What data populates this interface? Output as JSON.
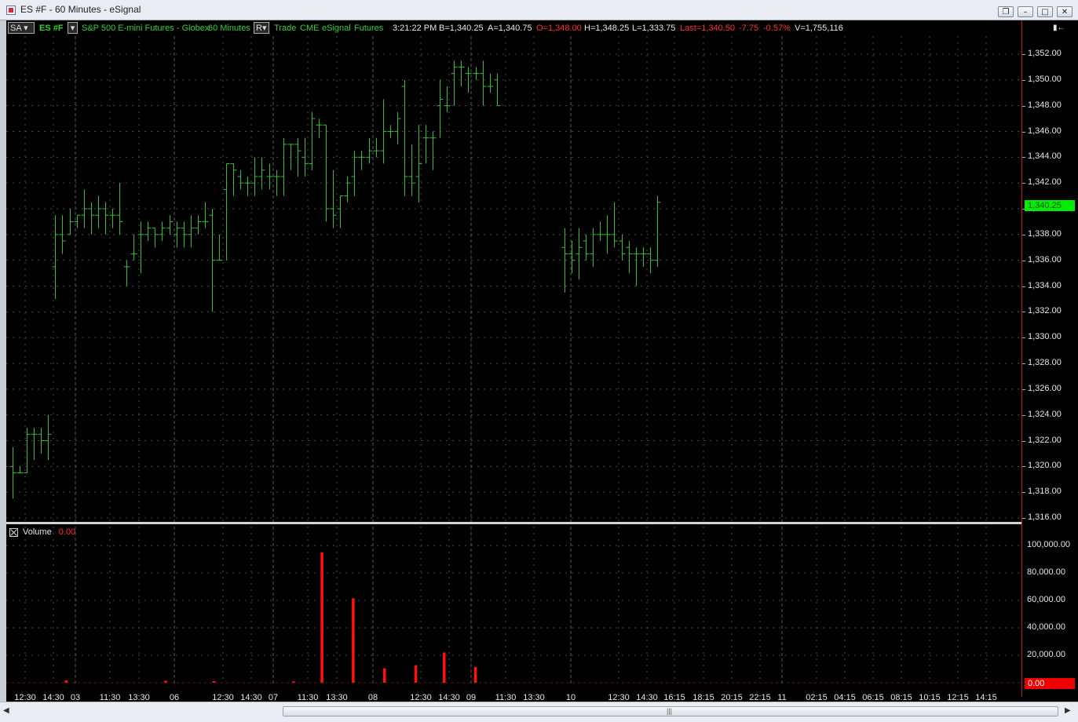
{
  "window": {
    "title": "ES #F - 60 Minutes - eSignal",
    "buttons": [
      "❐",
      "–",
      "□",
      "✕"
    ]
  },
  "toolbar": {
    "sa": "SA",
    "symbol": "ES #F",
    "description": "S&P 500 E-mini Futures - Globex",
    "interval": "60 Minutes",
    "r": "R",
    "trade": "Trade",
    "exchange": "CME",
    "source": "eSignal",
    "type": "Futures",
    "time": "3:21:22 PM",
    "bid": "B=1,340.25",
    "ask": "A=1,340.75",
    "open": "O=1,348.00",
    "high": "H=1,348.25",
    "low": "L=1,333.75",
    "last": "Last=1,340.50",
    "change": "-7.75",
    "change_pct": "-0.57%",
    "volume": "V=1,755,116",
    "menu_glyph": "▮←"
  },
  "price_axis": {
    "labels": [
      "1,352.00",
      "1,350.00",
      "1,348.00",
      "1,346.00",
      "1,344.00",
      "1,342.00",
      "1,340.00",
      "1,338.00",
      "1,336.00",
      "1,334.00",
      "1,332.00",
      "1,330.00",
      "1,328.00",
      "1,326.00",
      "1,324.00",
      "1,322.00",
      "1,320.00",
      "1,318.00",
      "1,316.00"
    ],
    "current_label": "1,340.25",
    "current_value": 1340.25
  },
  "volume_pane": {
    "title": "Volume",
    "value": "0.00",
    "axis_labels": [
      "100,000.00",
      "80,000.00",
      "60,000.00",
      "40,000.00",
      "20,000.00"
    ],
    "current_label": "0.00"
  },
  "time_axis": {
    "labels": [
      "12:30",
      "14:30",
      "03",
      "11:30",
      "13:30",
      "06",
      "12:30",
      "14:30",
      "07",
      "11:30",
      "13:30",
      "08",
      "12:30",
      "14:30",
      "09",
      "11:30",
      "13:30",
      "10",
      "12:30",
      "14:30",
      "16:15",
      "18:15",
      "20:15",
      "22:15",
      "11",
      "02:15",
      "04:15",
      "06:15",
      "08:15",
      "10:15",
      "12:15",
      "14:15"
    ]
  },
  "colors": {
    "bar": "#2fc02f",
    "volume": "#ff1010",
    "grid": "#4a4a4a",
    "price_marker": "#00ee00",
    "volume_marker": "#ee0000"
  },
  "chart_data": [
    {
      "type": "ohlc",
      "title": "S&P 500 E-mini Futures - Globex 60 Minutes",
      "ylim": [
        1316,
        1353
      ],
      "bars": [
        {
          "o": 1320.0,
          "h": 1321.5,
          "l": 1317.5,
          "c": 1319.5
        },
        {
          "o": 1319.5,
          "h": 1320.0,
          "l": 1319.5,
          "c": 1319.5
        },
        {
          "o": 1319.5,
          "h": 1323.0,
          "l": 1319.5,
          "c": 1322.5
        },
        {
          "o": 1322.5,
          "h": 1323.0,
          "l": 1320.5,
          "c": 1322.5
        },
        {
          "o": 1322.5,
          "h": 1323.0,
          "l": 1321.0,
          "c": 1322.0
        },
        {
          "o": 1322.0,
          "h": 1324.0,
          "l": 1320.5,
          "c": 1322.5
        },
        {
          "o": 1335.5,
          "h": 1339.5,
          "l": 1333.0,
          "c": 1338.0
        },
        {
          "o": 1338.0,
          "h": 1339.5,
          "l": 1336.5,
          "c": 1337.5
        },
        {
          "o": 1338.0,
          "h": 1340.0,
          "l": 1338.0,
          "c": 1339.0
        },
        {
          "o": 1339.0,
          "h": 1339.5,
          "l": 1338.5,
          "c": 1339.5
        },
        {
          "o": 1339.5,
          "h": 1341.5,
          "l": 1338.5,
          "c": 1340.0
        },
        {
          "o": 1340.0,
          "h": 1340.5,
          "l": 1338.0,
          "c": 1339.5
        },
        {
          "o": 1339.5,
          "h": 1341.0,
          "l": 1338.5,
          "c": 1340.0
        },
        {
          "o": 1340.0,
          "h": 1340.5,
          "l": 1338.0,
          "c": 1339.5
        },
        {
          "o": 1339.5,
          "h": 1340.0,
          "l": 1338.5,
          "c": 1339.5
        },
        {
          "o": 1339.5,
          "h": 1342.0,
          "l": 1338.0,
          "c": 1339.0
        },
        {
          "o": 1335.5,
          "h": 1336.0,
          "l": 1334.0,
          "c": 1335.5
        },
        {
          "o": 1336.5,
          "h": 1338.0,
          "l": 1336.0,
          "c": 1336.5
        },
        {
          "o": 1338.0,
          "h": 1339.0,
          "l": 1335.0,
          "c": 1338.0
        },
        {
          "o": 1338.0,
          "h": 1339.0,
          "l": 1337.5,
          "c": 1338.5
        },
        {
          "o": 1338.5,
          "h": 1338.5,
          "l": 1337.0,
          "c": 1338.0
        },
        {
          "o": 1338.0,
          "h": 1339.0,
          "l": 1337.5,
          "c": 1338.5
        },
        {
          "o": 1338.5,
          "h": 1339.5,
          "l": 1338.0,
          "c": 1339.0
        },
        {
          "o": 1338.0,
          "h": 1339.0,
          "l": 1337.0,
          "c": 1338.5
        },
        {
          "o": 1338.5,
          "h": 1339.0,
          "l": 1337.0,
          "c": 1338.0
        },
        {
          "o": 1338.0,
          "h": 1339.5,
          "l": 1337.0,
          "c": 1338.5
        },
        {
          "o": 1338.5,
          "h": 1339.5,
          "l": 1338.0,
          "c": 1339.0
        },
        {
          "o": 1339.0,
          "h": 1340.5,
          "l": 1338.5,
          "c": 1339.0
        },
        {
          "o": 1339.5,
          "h": 1340.0,
          "l": 1332.0,
          "c": 1336.0
        },
        {
          "o": 1336.0,
          "h": 1338.0,
          "l": 1336.0,
          "c": 1336.0
        },
        {
          "o": 1341.5,
          "h": 1343.5,
          "l": 1336.0,
          "c": 1343.5
        },
        {
          "o": 1343.5,
          "h": 1343.5,
          "l": 1341.0,
          "c": 1343.0
        },
        {
          "o": 1342.5,
          "h": 1343.0,
          "l": 1341.5,
          "c": 1342.0
        },
        {
          "o": 1342.0,
          "h": 1342.5,
          "l": 1341.0,
          "c": 1342.0
        },
        {
          "o": 1342.0,
          "h": 1344.0,
          "l": 1341.0,
          "c": 1342.5
        },
        {
          "o": 1342.5,
          "h": 1344.0,
          "l": 1341.5,
          "c": 1343.0
        },
        {
          "o": 1342.5,
          "h": 1343.5,
          "l": 1341.5,
          "c": 1342.5
        },
        {
          "o": 1342.5,
          "h": 1343.0,
          "l": 1341.0,
          "c": 1342.5
        },
        {
          "o": 1342.5,
          "h": 1345.5,
          "l": 1341.0,
          "c": 1345.0
        },
        {
          "o": 1345.0,
          "h": 1345.0,
          "l": 1343.0,
          "c": 1345.0
        },
        {
          "o": 1345.0,
          "h": 1345.5,
          "l": 1342.5,
          "c": 1344.5
        },
        {
          "o": 1344.0,
          "h": 1345.5,
          "l": 1342.5,
          "c": 1343.5
        },
        {
          "o": 1343.5,
          "h": 1347.5,
          "l": 1343.0,
          "c": 1347.0
        },
        {
          "o": 1346.5,
          "h": 1347.0,
          "l": 1345.5,
          "c": 1346.5
        },
        {
          "o": 1346.5,
          "h": 1346.5,
          "l": 1339.0,
          "c": 1340.0
        },
        {
          "o": 1340.0,
          "h": 1343.0,
          "l": 1338.5,
          "c": 1339.5
        },
        {
          "o": 1340.0,
          "h": 1341.0,
          "l": 1338.5,
          "c": 1341.0
        },
        {
          "o": 1341.0,
          "h": 1342.5,
          "l": 1340.5,
          "c": 1342.0
        },
        {
          "o": 1342.5,
          "h": 1344.5,
          "l": 1341.0,
          "c": 1344.0
        },
        {
          "o": 1344.0,
          "h": 1344.5,
          "l": 1343.0,
          "c": 1344.0
        },
        {
          "o": 1344.0,
          "h": 1345.5,
          "l": 1343.5,
          "c": 1344.5
        },
        {
          "o": 1344.5,
          "h": 1345.5,
          "l": 1344.0,
          "c": 1344.5
        },
        {
          "o": 1344.5,
          "h": 1348.5,
          "l": 1343.5,
          "c": 1346.0
        },
        {
          "o": 1346.0,
          "h": 1346.5,
          "l": 1345.5,
          "c": 1346.0
        },
        {
          "o": 1346.0,
          "h": 1347.5,
          "l": 1345.0,
          "c": 1347.0
        },
        {
          "o": 1349.5,
          "h": 1350.0,
          "l": 1341.0,
          "c": 1342.5
        },
        {
          "o": 1342.5,
          "h": 1345.0,
          "l": 1341.0,
          "c": 1342.0
        },
        {
          "o": 1342.5,
          "h": 1346.5,
          "l": 1340.5,
          "c": 1343.5
        },
        {
          "o": 1345.5,
          "h": 1346.5,
          "l": 1343.5,
          "c": 1345.5
        },
        {
          "o": 1345.5,
          "h": 1346.0,
          "l": 1343.0,
          "c": 1345.5
        },
        {
          "o": 1348.0,
          "h": 1350.0,
          "l": 1345.5,
          "c": 1348.5
        },
        {
          "o": 1348.0,
          "h": 1349.5,
          "l": 1347.5,
          "c": 1348.0
        },
        {
          "o": 1350.5,
          "h": 1351.5,
          "l": 1348.0,
          "c": 1351.0
        },
        {
          "o": 1351.0,
          "h": 1351.5,
          "l": 1349.5,
          "c": 1351.0
        },
        {
          "o": 1350.5,
          "h": 1351.0,
          "l": 1349.0,
          "c": 1350.5
        },
        {
          "o": 1350.5,
          "h": 1351.0,
          "l": 1350.0,
          "c": 1350.5
        },
        {
          "o": 1350.5,
          "h": 1351.5,
          "l": 1348.0,
          "c": 1349.5
        },
        {
          "o": 1349.5,
          "h": 1350.5,
          "l": 1349.0,
          "c": 1349.5
        },
        {
          "o": 1350.0,
          "h": 1350.5,
          "l": 1348.0,
          "c": 1348.0
        },
        {
          "o": 1337.0,
          "h": 1338.5,
          "l": 1333.5,
          "c": 1336.5
        },
        {
          "o": 1336.5,
          "h": 1337.5,
          "l": 1335.0,
          "c": 1336.0
        },
        {
          "o": 1336.5,
          "h": 1338.5,
          "l": 1334.5,
          "c": 1337.0
        },
        {
          "o": 1337.5,
          "h": 1338.0,
          "l": 1336.0,
          "c": 1336.5
        },
        {
          "o": 1336.5,
          "h": 1338.5,
          "l": 1335.5,
          "c": 1338.0
        },
        {
          "o": 1338.0,
          "h": 1339.0,
          "l": 1337.5,
          "c": 1338.0
        },
        {
          "o": 1338.0,
          "h": 1339.5,
          "l": 1336.5,
          "c": 1338.0
        },
        {
          "o": 1338.0,
          "h": 1340.5,
          "l": 1337.0,
          "c": 1337.5
        },
        {
          "o": 1337.5,
          "h": 1338.0,
          "l": 1336.0,
          "c": 1336.5
        },
        {
          "o": 1337.0,
          "h": 1337.5,
          "l": 1335.0,
          "c": 1336.5
        },
        {
          "o": 1336.5,
          "h": 1337.0,
          "l": 1334.0,
          "c": 1336.5
        },
        {
          "o": 1336.5,
          "h": 1337.0,
          "l": 1335.5,
          "c": 1336.5
        },
        {
          "o": 1336.5,
          "h": 1337.0,
          "l": 1335.0,
          "c": 1336.0
        },
        {
          "o": 1336.0,
          "h": 1341.0,
          "l": 1335.5,
          "c": 1340.5
        }
      ]
    },
    {
      "type": "bar",
      "title": "Volume",
      "ylim": [
        0,
        100000
      ],
      "values": [
        0,
        0,
        0,
        0,
        0,
        0,
        0,
        0,
        0,
        0,
        0,
        0,
        0,
        0,
        0,
        0,
        0,
        0,
        0,
        0,
        0,
        1800,
        0,
        0,
        0,
        0,
        0,
        0,
        0,
        0,
        0,
        0,
        0,
        0,
        0,
        0,
        0,
        0,
        0,
        0,
        0,
        0,
        0,
        0,
        0,
        0,
        0,
        0,
        0,
        0,
        0,
        0,
        0,
        0,
        0,
        0,
        1500,
        0,
        0,
        0,
        0,
        0,
        0,
        0,
        0,
        0,
        0,
        0,
        0,
        0,
        0,
        0,
        0,
        1200,
        0,
        0,
        0,
        0,
        0,
        0,
        0,
        0,
        0,
        0,
        0,
        0,
        0,
        0,
        0,
        0,
        0,
        0,
        0,
        0,
        0,
        0,
        0,
        0,
        0,
        0,
        0,
        1000,
        0,
        0,
        0,
        0,
        0,
        0,
        0,
        0,
        0,
        95000,
        0,
        0,
        0,
        0,
        0,
        0,
        0,
        0,
        0,
        0,
        61500,
        0,
        0,
        0,
        0,
        0,
        0,
        0,
        0,
        0,
        0,
        10500,
        0,
        0,
        0,
        0,
        0,
        0,
        0,
        0,
        0,
        0,
        12800,
        0,
        0,
        0,
        0,
        0,
        0,
        0,
        0,
        0,
        22000,
        0,
        0,
        0,
        0,
        0,
        0,
        0,
        0,
        0,
        0,
        11500
      ]
    }
  ]
}
